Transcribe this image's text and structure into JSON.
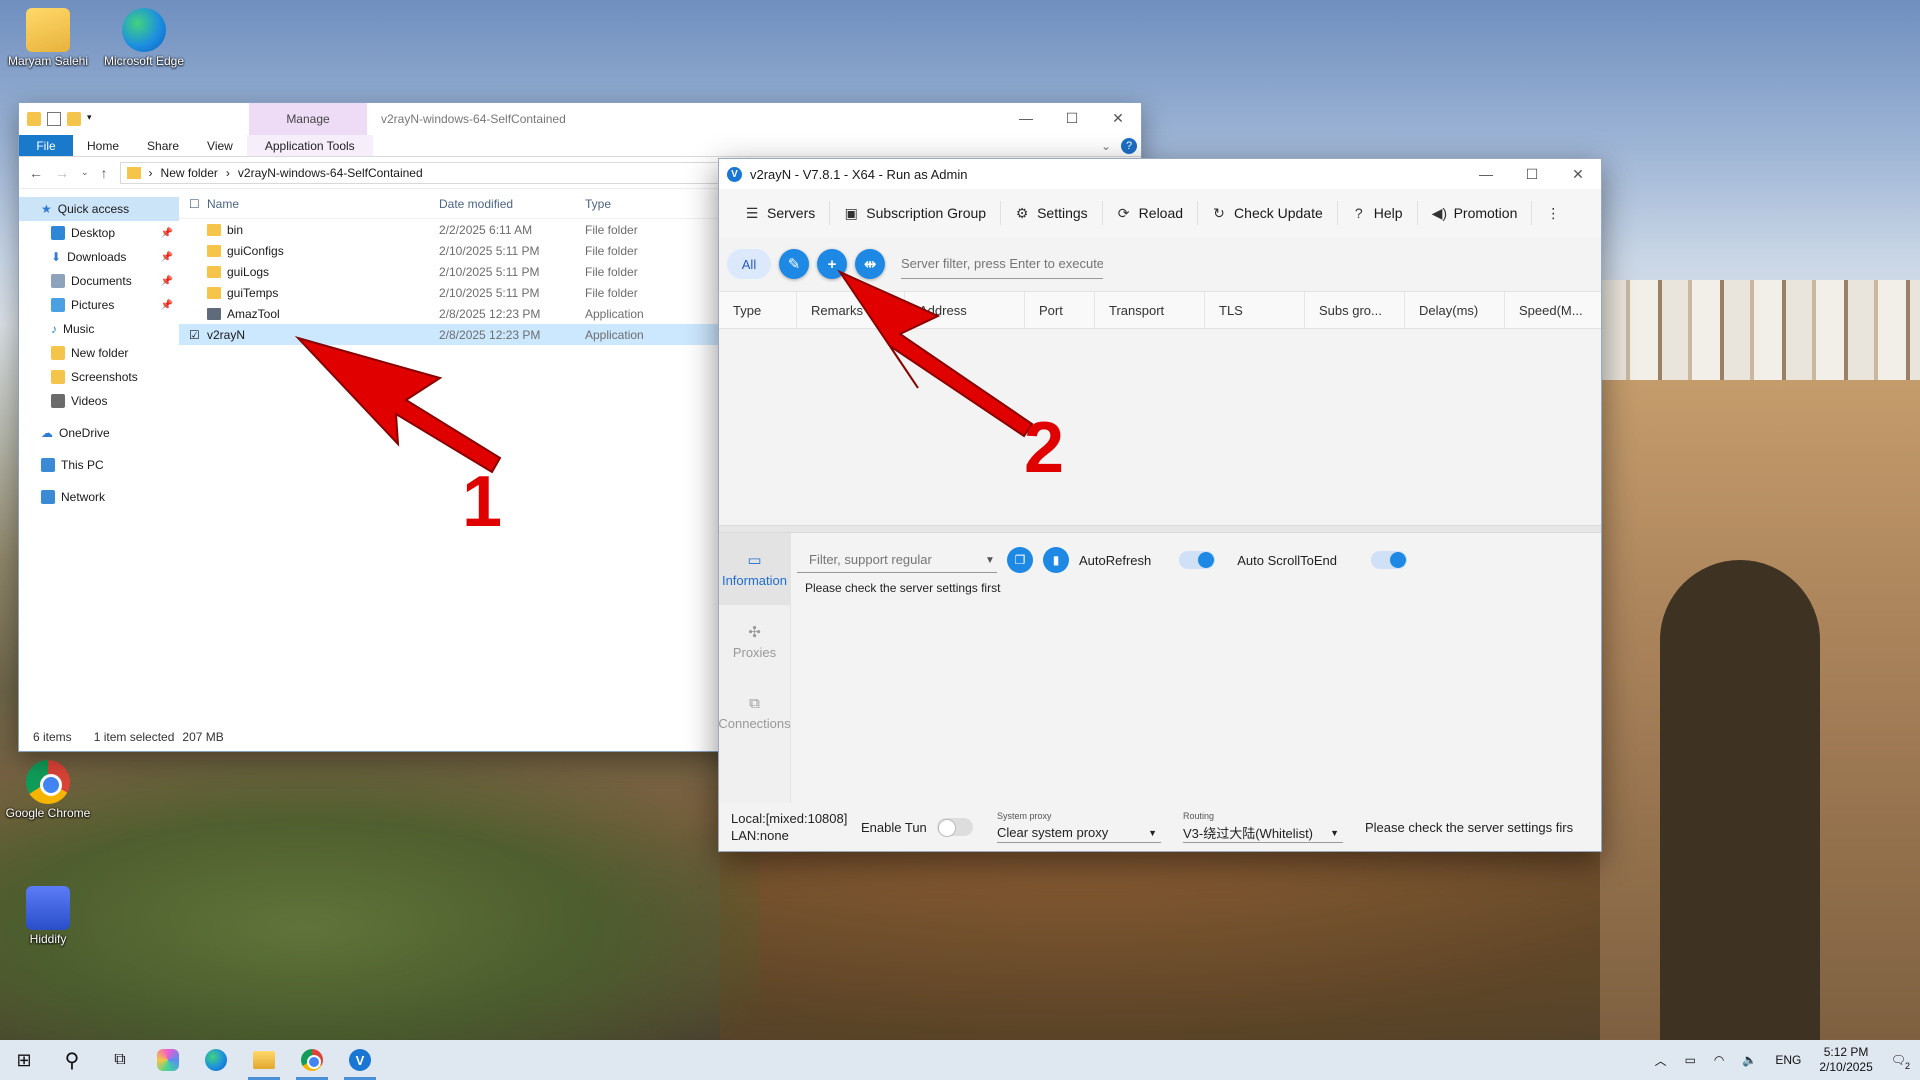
{
  "desktop": {
    "icons": [
      {
        "label": "Maryam Salehi"
      },
      {
        "label": "Microsoft Edge"
      },
      {
        "label": "Google Chrome"
      },
      {
        "label": "Hiddify"
      }
    ]
  },
  "explorer": {
    "manage_tab": "Manage",
    "window_title": "v2rayN-windows-64-SelfContained",
    "ribbon": {
      "file": "File",
      "home": "Home",
      "share": "Share",
      "view": "View",
      "app_tools": "Application Tools"
    },
    "breadcrumb": {
      "part1": "New folder",
      "part2": "v2rayN-windows-64-SelfContained"
    },
    "nav": [
      {
        "label": "Quick access"
      },
      {
        "label": "Desktop"
      },
      {
        "label": "Downloads"
      },
      {
        "label": "Documents"
      },
      {
        "label": "Pictures"
      },
      {
        "label": "Music"
      },
      {
        "label": "New folder"
      },
      {
        "label": "Screenshots"
      },
      {
        "label": "Videos"
      },
      {
        "label": "OneDrive"
      },
      {
        "label": "This PC"
      },
      {
        "label": "Network"
      }
    ],
    "columns": {
      "name": "Name",
      "date": "Date modified",
      "type": "Type"
    },
    "files": [
      {
        "name": "bin",
        "date": "2/2/2025 6:11 AM",
        "type": "File folder"
      },
      {
        "name": "guiConfigs",
        "date": "2/10/2025 5:11 PM",
        "type": "File folder"
      },
      {
        "name": "guiLogs",
        "date": "2/10/2025 5:11 PM",
        "type": "File folder"
      },
      {
        "name": "guiTemps",
        "date": "2/10/2025 5:11 PM",
        "type": "File folder"
      },
      {
        "name": "AmazTool",
        "date": "2/8/2025 12:23 PM",
        "type": "Application"
      },
      {
        "name": "v2rayN",
        "date": "2/8/2025 12:23 PM",
        "type": "Application"
      }
    ],
    "status": {
      "items": "6 items",
      "selected": "1 item selected",
      "size": "207 MB"
    }
  },
  "v2rayn": {
    "title": "v2rayN - V7.8.1 - X64 - Run as Admin",
    "menu": {
      "servers": "Servers",
      "subscription": "Subscription Group",
      "settings": "Settings",
      "reload": "Reload",
      "check_update": "Check Update",
      "help": "Help",
      "promotion": "Promotion"
    },
    "toolbar": {
      "all": "All",
      "filter_placeholder": "Server filter, press Enter to execute"
    },
    "grid_columns": [
      "Type",
      "Remarks",
      "Address",
      "Port",
      "Transport",
      "TLS",
      "Subs gro...",
      "Delay(ms)",
      "Speed(M..."
    ],
    "side_tabs": {
      "information": "Information",
      "proxies": "Proxies",
      "connections": "Connections"
    },
    "log": {
      "filter_placeholder": "Filter, support regular",
      "auto_refresh": "AutoRefresh",
      "auto_scroll": "Auto ScrollToEnd",
      "message": "Please check the server settings first"
    },
    "status": {
      "local": "Local:[mixed:10808]",
      "lan": "LAN:none",
      "enable_tun": "Enable Tun",
      "system_proxy_caption": "System proxy",
      "system_proxy_value": "Clear system proxy",
      "routing_caption": "Routing",
      "routing_value": "V3-绕过大陆(Whitelist)",
      "message": "Please check the server settings firs"
    }
  },
  "annotations": {
    "one": "1",
    "two": "2"
  },
  "taskbar": {
    "lang": "ENG",
    "time": "5:12 PM",
    "date": "2/10/2025",
    "notif_count": "2"
  }
}
